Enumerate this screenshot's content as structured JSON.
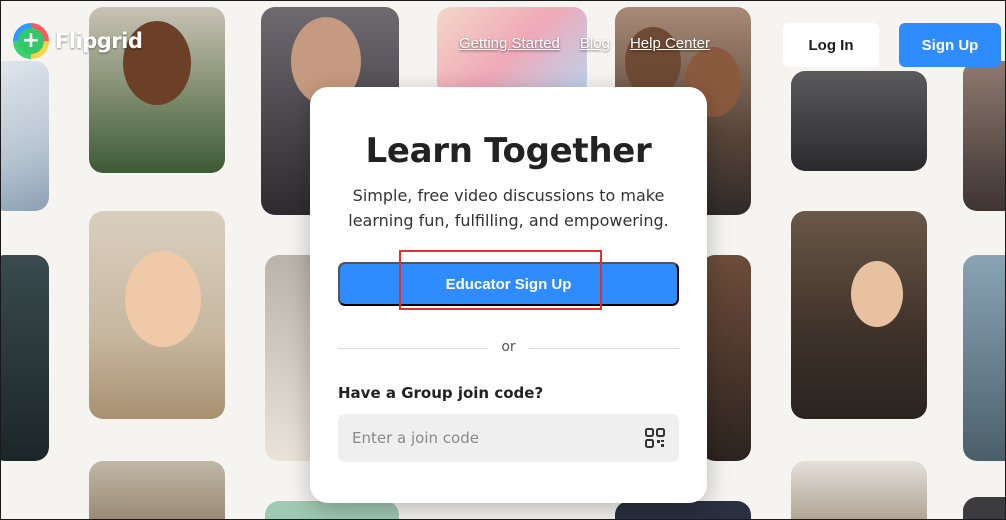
{
  "brand": {
    "name": "Flipgrid"
  },
  "nav": {
    "links": [
      "Getting Started",
      "Blog",
      "Help Center"
    ]
  },
  "header": {
    "login_label": "Log In",
    "signup_label": "Sign Up"
  },
  "card": {
    "title": "Learn Together",
    "subtitle": "Simple, free video discussions to make learning fun, fulfilling, and empowering.",
    "educator_button": "Educator Sign Up",
    "divider_text": "or",
    "join_label": "Have a Group join code?",
    "join_placeholder": "Enter a join code"
  },
  "colors": {
    "accent": "#2e8cff",
    "highlight": "#e03030"
  }
}
